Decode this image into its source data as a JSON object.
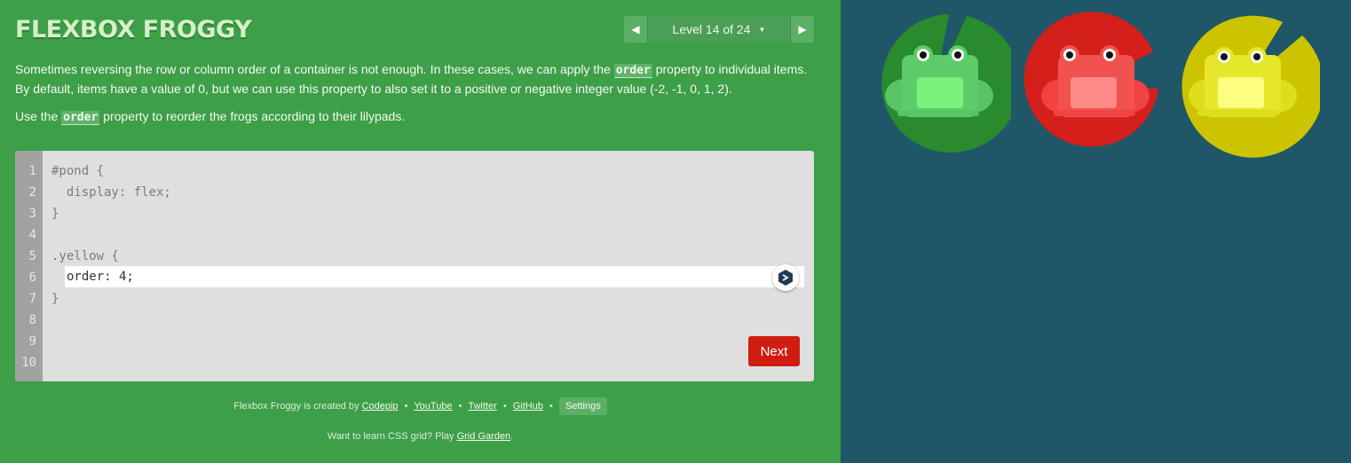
{
  "header": {
    "title": "FLEXBOX FROGGY",
    "level_label": "Level 14 of 24"
  },
  "instructions": {
    "p1_before": "Sometimes reversing the row or column order of a container is not enough. In these cases, we can apply the ",
    "p1_keyword": "order",
    "p1_after": " property to individual items. By default, items have a value of 0, but we can use this property to also set it to a positive or negative integer value (-2, -1, 0, 1, 2).",
    "p2_before": "Use the ",
    "p2_keyword": "order",
    "p2_after": " property to reorder the frogs according to their lilypads."
  },
  "editor": {
    "line_numbers": [
      "1",
      "2",
      "3",
      "4",
      "5",
      "6",
      "7",
      "8",
      "9",
      "10"
    ],
    "line1": "#pond {",
    "line2": "  display: flex;",
    "line3": "}",
    "line5": ".yellow {",
    "input_value": "order: 4;",
    "line7": "}",
    "next_label": "Next"
  },
  "footer": {
    "credit_prefix": "Flexbox Froggy is created by",
    "link_codepip": "Codepip",
    "link_youtube": "YouTube",
    "link_twitter": "Twitter",
    "link_github": "GitHub",
    "bullet": "•",
    "settings_label": "Settings",
    "promo_prefix": "Want to learn CSS grid? Play",
    "promo_link": "Grid Garden",
    "promo_suffix": "."
  },
  "pond": {
    "frogs": [
      "green",
      "red",
      "yellow"
    ],
    "colors": {
      "background": "#1f5768",
      "sidebar": "#3d9f48",
      "green_pad": "#2a8a2e",
      "red_pad": "#d41f1b",
      "yellow_pad": "#cdc400",
      "next_button": "#cf1d12"
    }
  }
}
